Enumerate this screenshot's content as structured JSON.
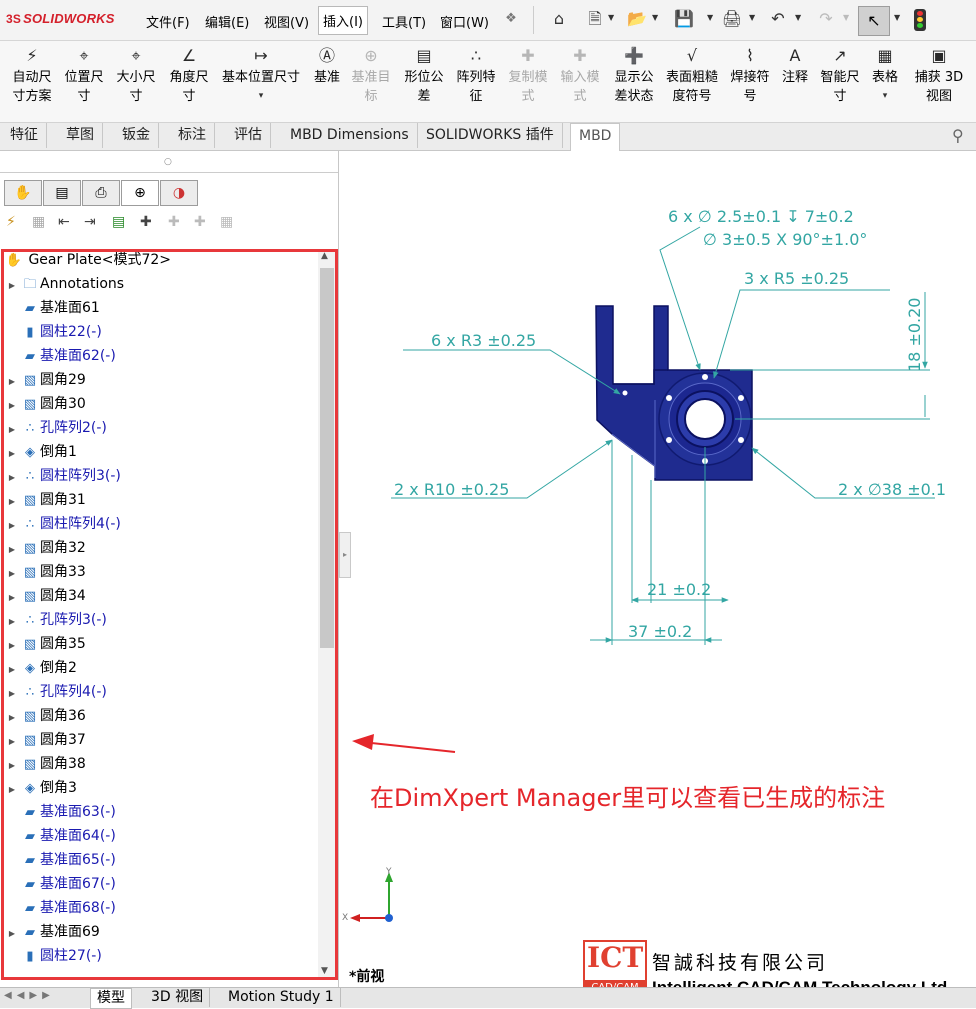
{
  "app": {
    "logo": "SOLIDWORKS",
    "logo_prefix": "3S"
  },
  "menu": [
    "文件(F)",
    "编辑(E)",
    "视图(V)",
    "插入(I)",
    "工具(T)",
    "窗口(W)"
  ],
  "quick_access": [
    "home-icon",
    "new-document-icon",
    "open-icon",
    "save-icon",
    "print-icon",
    "undo-icon",
    "redo-icon",
    "select-arrow-icon",
    "rebuild-traffic-light-icon"
  ],
  "ribbon": [
    {
      "label": "自动尺寸方案",
      "l1": "自动尺",
      "l2": "寸方案",
      "icon": "auto-dimension-scheme-icon",
      "disabled": false
    },
    {
      "label": "位置尺寸",
      "l1": "位置尺",
      "l2": "寸",
      "icon": "location-dimension-icon",
      "disabled": false
    },
    {
      "label": "大小尺寸",
      "l1": "大小尺",
      "l2": "寸",
      "icon": "size-dimension-icon",
      "disabled": false
    },
    {
      "label": "角度尺寸",
      "l1": "角度尺",
      "l2": "寸",
      "icon": "angle-dimension-icon",
      "disabled": false
    },
    {
      "label": "基本位置尺寸",
      "l1": "基本位置尺寸",
      "l2": "",
      "icon": "basic-location-dimension-icon",
      "disabled": false
    },
    {
      "label": "基准",
      "l1": "基准",
      "l2": "",
      "icon": "datum-icon",
      "disabled": false
    },
    {
      "label": "基准目标",
      "l1": "基准目",
      "l2": "标",
      "icon": "datum-target-icon",
      "disabled": true
    },
    {
      "label": "形位公差",
      "l1": "形位公",
      "l2": "差",
      "icon": "geometric-tolerance-icon",
      "disabled": false
    },
    {
      "label": "阵列特征",
      "l1": "阵列特",
      "l2": "征",
      "icon": "pattern-feature-icon",
      "disabled": false
    },
    {
      "label": "复制模式",
      "l1": "复制模",
      "l2": "式",
      "icon": "copy-scheme-icon",
      "disabled": true
    },
    {
      "label": "输入模式",
      "l1": "输入模",
      "l2": "式",
      "icon": "import-scheme-icon",
      "disabled": true
    },
    {
      "label": "显示公差状态",
      "l1": "显示公",
      "l2": "差状态",
      "icon": "show-tolerance-status-icon",
      "disabled": false
    },
    {
      "label": "表面粗糙度符号",
      "l1": "表面粗糙",
      "l2": "度符号",
      "icon": "surface-finish-icon",
      "disabled": false
    },
    {
      "label": "焊接符号",
      "l1": "焊接符",
      "l2": "号",
      "icon": "weld-symbol-icon",
      "disabled": false
    },
    {
      "label": "注释",
      "l1": "注释",
      "l2": "",
      "icon": "note-icon",
      "disabled": false
    },
    {
      "label": "智能尺寸",
      "l1": "智能尺",
      "l2": "寸",
      "icon": "smart-dimension-icon",
      "disabled": false
    },
    {
      "label": "表格",
      "l1": "表格",
      "l2": "",
      "icon": "table-icon",
      "disabled": false
    },
    {
      "label": "捕获3D视图",
      "l1": "捕获 3D",
      "l2": "视图",
      "icon": "capture-3d-view-icon",
      "disabled": false
    }
  ],
  "tabs": [
    "特征",
    "草图",
    "钣金",
    "标注",
    "评估",
    "MBD Dimensions",
    "SOLIDWORKS 插件",
    "MBD"
  ],
  "active_tab": "MBD",
  "panel_tabs": [
    "feature-manager-icon",
    "property-manager-icon",
    "configuration-manager-icon",
    "dimxpert-manager-icon",
    "display-manager-icon"
  ],
  "tree": {
    "root": "Gear Plate<模式72>",
    "items": [
      {
        "label": "Annotations",
        "icon": "annotations-folder-icon",
        "expand": true,
        "blue": false
      },
      {
        "label": "基准面61",
        "icon": "plane-feature-icon",
        "expand": false,
        "blue": false
      },
      {
        "label": "圆柱22(-)",
        "icon": "cylinder-feature-icon",
        "expand": false,
        "blue": true
      },
      {
        "label": "基准面62(-)",
        "icon": "plane-feature-icon",
        "expand": false,
        "blue": true
      },
      {
        "label": "圆角29",
        "icon": "fillet-feature-icon",
        "expand": true,
        "blue": false
      },
      {
        "label": "圆角30",
        "icon": "fillet-feature-icon",
        "expand": true,
        "blue": false
      },
      {
        "label": "孔阵列2(-)",
        "icon": "hole-pattern-icon",
        "expand": true,
        "blue": true
      },
      {
        "label": "倒角1",
        "icon": "chamfer-feature-icon",
        "expand": true,
        "blue": false
      },
      {
        "label": "圆柱阵列3(-)",
        "icon": "hole-pattern-icon",
        "expand": true,
        "blue": true
      },
      {
        "label": "圆角31",
        "icon": "fillet-feature-icon",
        "expand": true,
        "blue": false
      },
      {
        "label": "圆柱阵列4(-)",
        "icon": "hole-pattern-icon",
        "expand": true,
        "blue": true
      },
      {
        "label": "圆角32",
        "icon": "fillet-feature-icon",
        "expand": true,
        "blue": false
      },
      {
        "label": "圆角33",
        "icon": "fillet-feature-icon",
        "expand": true,
        "blue": false
      },
      {
        "label": "圆角34",
        "icon": "fillet-feature-icon",
        "expand": true,
        "blue": false
      },
      {
        "label": "孔阵列3(-)",
        "icon": "hole-pattern-icon",
        "expand": true,
        "blue": true
      },
      {
        "label": "圆角35",
        "icon": "fillet-feature-icon",
        "expand": true,
        "blue": false
      },
      {
        "label": "倒角2",
        "icon": "chamfer-feature-icon",
        "expand": true,
        "blue": false
      },
      {
        "label": "孔阵列4(-)",
        "icon": "hole-pattern-icon",
        "expand": true,
        "blue": true
      },
      {
        "label": "圆角36",
        "icon": "fillet-feature-icon",
        "expand": true,
        "blue": false
      },
      {
        "label": "圆角37",
        "icon": "fillet-feature-icon",
        "expand": true,
        "blue": false
      },
      {
        "label": "圆角38",
        "icon": "fillet-feature-icon",
        "expand": true,
        "blue": false
      },
      {
        "label": "倒角3",
        "icon": "chamfer-feature-icon",
        "expand": true,
        "blue": false
      },
      {
        "label": "基准面63(-)",
        "icon": "plane-feature-icon",
        "expand": false,
        "blue": true
      },
      {
        "label": "基准面64(-)",
        "icon": "plane-feature-icon",
        "expand": false,
        "blue": true
      },
      {
        "label": "基准面65(-)",
        "icon": "plane-feature-icon",
        "expand": false,
        "blue": true
      },
      {
        "label": "基准面67(-)",
        "icon": "plane-feature-icon",
        "expand": false,
        "blue": true
      },
      {
        "label": "基准面68(-)",
        "icon": "plane-feature-icon",
        "expand": false,
        "blue": true
      },
      {
        "label": "基准面69",
        "icon": "plane-feature-icon",
        "expand": true,
        "blue": false
      },
      {
        "label": "圆柱27(-)",
        "icon": "cylinder-feature-icon",
        "expand": false,
        "blue": true
      }
    ]
  },
  "dimensions": {
    "hole_callout_1": "6 x ∅ 2.5±0.1 ↧ 7±0.2",
    "hole_callout_2": "∅ 3±0.5 X 90°±1.0°",
    "r5": "3 x R5 ±0.25",
    "r3": "6 x R3 ±0.25",
    "h18": "18 ±0.20",
    "r10": "2 x R10 ±0.25",
    "d38": "2 x ∅38 ±0.1",
    "w21": "21 ±0.2",
    "w37": "37 ±0.2"
  },
  "annotation": "在DimXpert Manager里可以查看已生成的标注",
  "view_label": "*前视",
  "triad": {
    "x": "X",
    "y": "Y"
  },
  "bottom_tabs": [
    "模型",
    "3D 视图",
    "Motion Study 1"
  ],
  "watermark": {
    "logo_main": "ICT",
    "logo_sub": "CAD/CAM",
    "cn": "智誠科技有限公司",
    "en": "Intelligent CAD/CAM Technology Ltd."
  },
  "colors": {
    "accent_red": "#e8383b",
    "dimension": "#33a6a3",
    "part_blue": "#1f2b8f",
    "logo_red": "#d4202b"
  }
}
